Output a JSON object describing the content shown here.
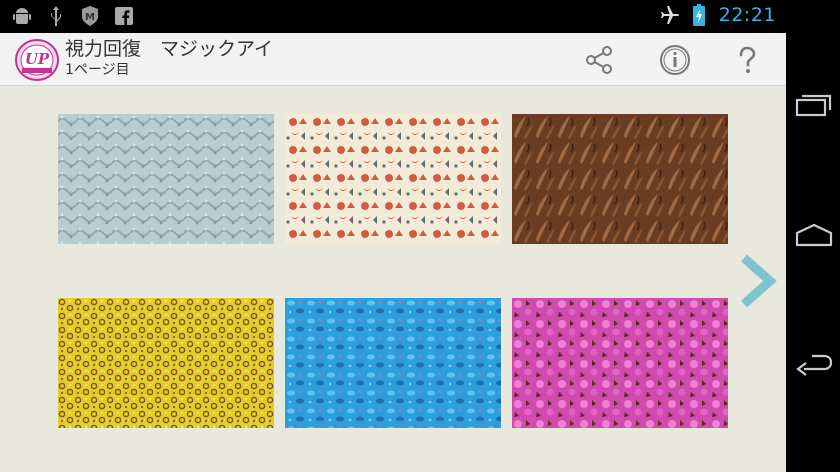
{
  "status_bar": {
    "time": "22:21",
    "left_icons": [
      "android-debug-icon",
      "usb-icon",
      "security-app-icon",
      "facebook-icon"
    ],
    "right_icons": [
      "airplane-mode-icon",
      "battery-charging-icon"
    ],
    "clock_color": "#33b5e5"
  },
  "action_bar": {
    "title": "視力回復　マジックアイ",
    "subtitle": "1ページ目",
    "logo_text": "UP",
    "buttons": [
      "share-icon",
      "info-icon",
      "help-icon"
    ]
  },
  "gallery": {
    "accent_arrow_color": "#7dc3d0",
    "background_color": "#e9e8dc",
    "thumbnails": [
      {
        "name": "stereogram-blue-gray",
        "colors": [
          "#b9ccd0",
          "#8fa8ae",
          "#d7e3e4"
        ]
      },
      {
        "name": "stereogram-red-flowers",
        "colors": [
          "#f4ead8",
          "#cf5d43",
          "#5f6f72"
        ]
      },
      {
        "name": "stereogram-brown-leaves",
        "colors": [
          "#6a3d22",
          "#a06a45",
          "#3c2112"
        ]
      },
      {
        "name": "stereogram-yellow-honeycomb",
        "colors": [
          "#e0cf2a",
          "#8a4b17",
          "#f3ea6a"
        ]
      },
      {
        "name": "stereogram-blue-cyan",
        "colors": [
          "#2e9ddc",
          "#5fc4ef",
          "#1f6fa8"
        ]
      },
      {
        "name": "stereogram-pink-magenta",
        "colors": [
          "#cf4cae",
          "#f17fd5",
          "#5a2a1c"
        ]
      }
    ]
  },
  "nav_bar": {
    "buttons": [
      "recent-apps-icon",
      "home-icon",
      "back-icon"
    ]
  }
}
